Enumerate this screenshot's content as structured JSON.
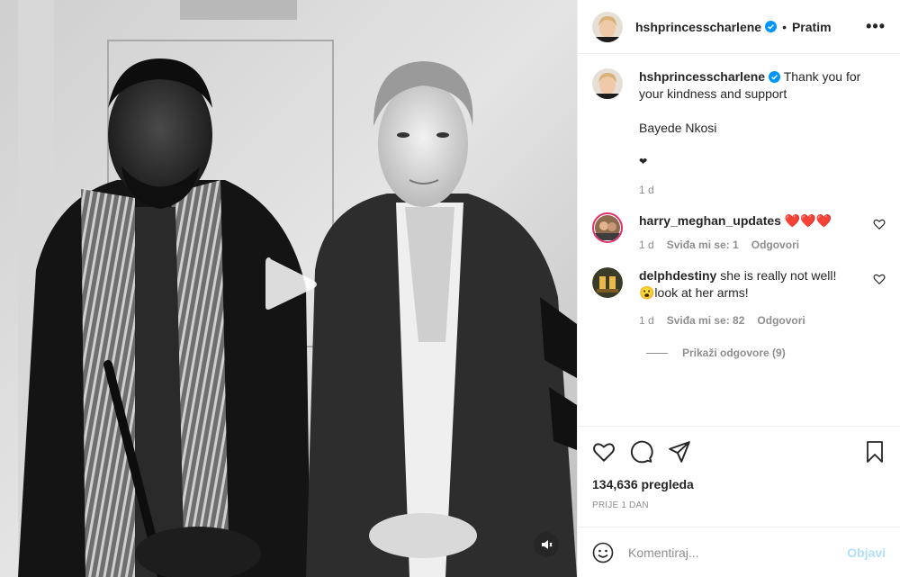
{
  "post": {
    "author": "hshprincesscharlene",
    "follow_label": "Pratim",
    "more_label": "•••",
    "separator": "•"
  },
  "caption": {
    "username": "hshprincesscharlene",
    "line1": "Thank you for",
    "line2": "your kindness and support",
    "line3": "Bayede Nkosi",
    "line4": "❤",
    "time": "1 d"
  },
  "comments": [
    {
      "username": "harry_meghan_updates",
      "text": "❤️❤️❤️",
      "time": "1 d",
      "likes": "Sviđa mi se: 1",
      "reply_label": "Odgovori"
    },
    {
      "username": "delphdestiny",
      "text": "she is really not well!",
      "text2": "😮look at her arms!",
      "time": "1 d",
      "likes": "Sviđa mi se: 82",
      "reply_label": "Odgovori"
    }
  ],
  "view_replies": "Prikaži odgovore (9)",
  "stats": {
    "views": "134,636 pregleda",
    "posted": "PRIJE 1 DAN"
  },
  "composer": {
    "placeholder": "Komentiraj...",
    "post_label": "Objavi"
  },
  "colors": {
    "verified": "#0095f6",
    "secondary_text": "#8e8e8e",
    "post_disabled": "#b2dffc",
    "heart": "#ed4956"
  },
  "icons": [
    "play-icon",
    "volume-icon",
    "verified-icon",
    "heart-icon",
    "comment-icon",
    "share-icon",
    "bookmark-icon",
    "emoji-icon"
  ]
}
